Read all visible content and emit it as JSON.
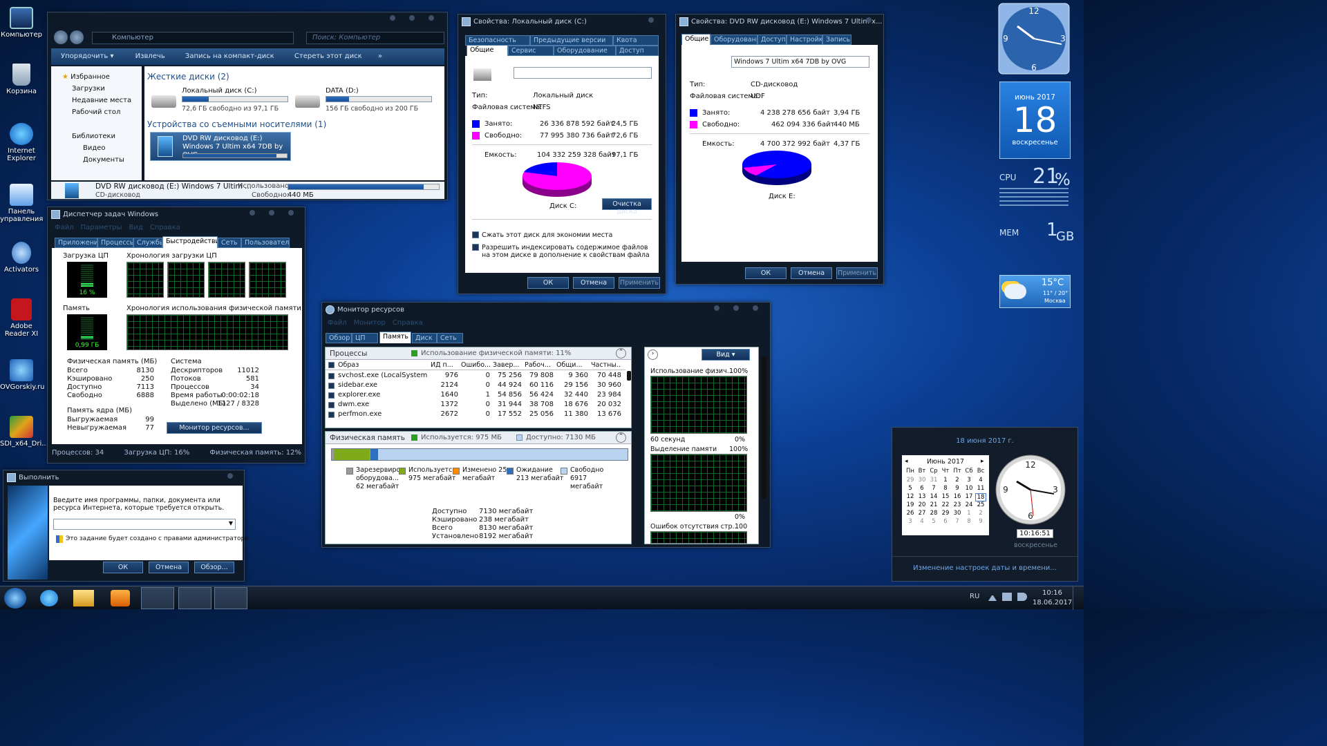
{
  "desktop_icons": [
    "Компьютер",
    "Корзина",
    "Internet Explorer",
    "Панель управления",
    "Activators",
    "Adobe Reader XI",
    "OVGorskiy.ru",
    "SDI_x64_Dri..."
  ],
  "explorer": {
    "address": "Компьютер",
    "search_placeholder": "Поиск: Компьютер",
    "toolbar": [
      "Упорядочить ▾",
      "Извлечь",
      "Запись на компакт-диск",
      "Стереть этот диск",
      "»"
    ],
    "nav": {
      "favorites": "Избранное",
      "fav_items": [
        "Загрузки",
        "Недавние места",
        "Рабочий стол"
      ],
      "libraries": "Библиотеки",
      "lib_items": [
        "Видео",
        "Документы"
      ]
    },
    "hdd_group": "Жесткие диски (2)",
    "drive_c": {
      "name": "Локальный диск (C:)",
      "free": "72,6 ГБ свободно из 97,1 ГБ",
      "used_fraction": 0.25
    },
    "drive_d": {
      "name": "DATA (D:)",
      "free": "156 ГБ свободно из 200 ГБ",
      "used_fraction": 0.22
    },
    "removable_group": "Устройства со съемными носителями (1)",
    "dvd_tile": "DVD RW дисковод (E:) Windows 7 Ultim x64 7DB by OVG",
    "details": {
      "name": "DVD RW дисковод (E:) Windows 7 Ultim ...",
      "type": "CD-дисковод",
      "used_label": "Использовано:",
      "free_label": "Свободно:",
      "free_value": "440 МБ",
      "used_fraction": 0.9
    }
  },
  "props_c": {
    "title": "Свойства: Локальный диск (C:)",
    "tabs_top": [
      "Безопасность",
      "Предыдущие версии",
      "Квота"
    ],
    "tabs_bottom": [
      "Общие",
      "Сервис",
      "Оборудование",
      "Доступ"
    ],
    "type_label": "Тип:",
    "type_value": "Локальный диск",
    "fs_label": "Файловая система:",
    "fs_value": "NTFS",
    "used_label": "Занято:",
    "used_bytes": "26 336 878 592 байт",
    "used_gb": "24,5 ГБ",
    "free_label": "Свободно:",
    "free_bytes": "77 995 380 736 байт",
    "free_gb": "72,6 ГБ",
    "cap_label": "Емкость:",
    "cap_bytes": "104 332 259 328 байт",
    "cap_gb": "97,1 ГБ",
    "disk_label": "Диск C:",
    "cleanup": "Очистка диска",
    "compress": "Сжать этот диск для экономии места",
    "index": "Разрешить индексировать содержимое файлов на этом диске в дополнение к свойствам файла",
    "buttons": [
      "ОК",
      "Отмена",
      "Применить"
    ],
    "used_color": "#0000ff",
    "free_color": "#ff00ff"
  },
  "props_e": {
    "title": "Свойства: DVD RW дисковод (E:) Windows 7 Ultim x...",
    "tabs": [
      "Общие",
      "Оборудование",
      "Доступ",
      "Настройка",
      "Запись"
    ],
    "label_value": "Windows 7 Ultim x64 7DB by OVG",
    "type_label": "Тип:",
    "type_value": "CD-дисковод",
    "fs_label": "Файловая система:",
    "fs_value": "UDF",
    "used_label": "Занято:",
    "used_bytes": "4 238 278 656 байт",
    "used_gb": "3,94 ГБ",
    "free_label": "Свободно:",
    "free_bytes": "462 094 336 байт",
    "free_gb": "440 МБ",
    "cap_label": "Емкость:",
    "cap_bytes": "4 700 372 992 байт",
    "cap_gb": "4,37 ГБ",
    "disk_label": "Диск E:",
    "buttons": [
      "ОК",
      "Отмена",
      "Применить"
    ]
  },
  "taskmgr": {
    "title": "Диспетчер задач Windows",
    "menu": [
      "Файл",
      "Параметры",
      "Вид",
      "Справка"
    ],
    "tabs": [
      "Приложения",
      "Процессы",
      "Службы",
      "Быстродействие",
      "Сеть",
      "Пользователи"
    ],
    "cpu_label": "Загрузка ЦП",
    "cpu_value": "16 %",
    "cpu_fraction": 0.16,
    "cpu_hist_label": "Хронология загрузки ЦП",
    "mem_label": "Память",
    "mem_value": "0,99 ГБ",
    "mem_fraction": 0.12,
    "mem_hist_label": "Хронология использования физической памяти",
    "phys_title": "Физическая память (МБ)",
    "phys": [
      [
        "Всего",
        "8130"
      ],
      [
        "Кэшировано",
        "250"
      ],
      [
        "Доступно",
        "7113"
      ],
      [
        "Свободно",
        "6888"
      ]
    ],
    "kernel_title": "Память ядра (МБ)",
    "kernel": [
      [
        "Выгружаемая",
        "99"
      ],
      [
        "Невыгружаемая",
        "77"
      ]
    ],
    "system_title": "Система",
    "system": [
      [
        "Дескрипторов",
        "11012"
      ],
      [
        "Потоков",
        "581"
      ],
      [
        "Процессов",
        "34"
      ],
      [
        "Время работы",
        "0:00:02:18"
      ],
      [
        "Выделено (МБ)",
        "1127 / 8328"
      ]
    ],
    "resmon_button": "Монитор ресурсов...",
    "status": [
      "Процессов: 34",
      "Загрузка ЦП: 16%",
      "Физическая память: 12%"
    ]
  },
  "resmon": {
    "title": "Монитор ресурсов",
    "menu": [
      "Файл",
      "Монитор",
      "Справка"
    ],
    "tabs": [
      "Обзор",
      "ЦП",
      "Память",
      "Диск",
      "Сеть"
    ],
    "proc_header": "Процессы",
    "proc_usage": "Использование физической памяти: 11%",
    "columns": [
      "Образ",
      "ИД п...",
      "Ошибо...",
      "Завер...",
      "Рабоч...",
      "Общи...",
      "Частны..."
    ],
    "rows": [
      [
        "svchost.exe (LocalSystemNet...",
        "976",
        "0",
        "75 256",
        "79 808",
        "9 360",
        "70 448"
      ],
      [
        "sidebar.exe",
        "2124",
        "0",
        "44 924",
        "60 116",
        "29 156",
        "30 960"
      ],
      [
        "explorer.exe",
        "1640",
        "1",
        "54 856",
        "56 424",
        "32 440",
        "23 984"
      ],
      [
        "dwm.exe",
        "1372",
        "0",
        "31 944",
        "38 708",
        "18 676",
        "20 032"
      ],
      [
        "perfmon.exe",
        "2672",
        "0",
        "17 552",
        "25 056",
        "11 380",
        "13 676"
      ]
    ],
    "phys_header": "Физическая память",
    "phys_used": "Используется: 975 МБ",
    "phys_avail": "Доступно: 7130 МБ",
    "legend": [
      {
        "label": "Зарезервиро оборудова... 62 мегабайт",
        "color": "#9a9a9a"
      },
      {
        "label": "Используется 975 мегабайт",
        "color": "#7fab1b"
      },
      {
        "label": "Изменено 25 мегабайт",
        "color": "#ff8c00"
      },
      {
        "label": "Ожидание 213 мегабайт",
        "color": "#2f6fbf"
      },
      {
        "label": "Свободно 6917 мегабайт",
        "color": "#b9d3f0"
      }
    ],
    "summary": [
      [
        "Доступно",
        "7130 мегабайт"
      ],
      [
        "Кэшировано",
        "238 мегабайт"
      ],
      [
        "Всего",
        "8130 мегабайт"
      ],
      [
        "Установлено",
        "8192 мегабайт"
      ]
    ],
    "view_button": "Вид",
    "graph1_label": "Использование физич...",
    "graph1_max": "100%",
    "graph1_x": "60 секунд",
    "graph1_min": "0%",
    "graph2_label": "Выделение памяти",
    "graph2_max": "100%",
    "graph2_min": "0%",
    "graph3_label": "Ошибок отсутствия стр...",
    "graph3_max": "100"
  },
  "run": {
    "title": "Выполнить",
    "desc": "Введите имя программы, папки, документа или ресурса Интернета, которые требуется открыть.",
    "admin": "Это задание будет создано с правами администратора",
    "buttons": [
      "ОК",
      "Отмена",
      "Обзор..."
    ]
  },
  "gadgets": {
    "calendar_month": "июнь 2017",
    "calendar_day": "18",
    "calendar_weekday": "воскресенье",
    "cpu_label": "CPU",
    "cpu_value": "21",
    "cpu_unit": "%",
    "mem_label": "MEM",
    "mem_value": "1",
    "mem_unit": "GB",
    "weather_temp": "15°C",
    "weather_range": "11° / 20°",
    "weather_city": "Москва"
  },
  "datetime_popup": {
    "date_header": "18 июня 2017 г.",
    "month": "Июнь 2017",
    "weekdays": [
      "Пн",
      "Вт",
      "Ср",
      "Чт",
      "Пт",
      "Сб",
      "Вс"
    ],
    "days": [
      [
        "29",
        "30",
        "31",
        "1",
        "2",
        "3",
        "4"
      ],
      [
        "5",
        "6",
        "7",
        "8",
        "9",
        "10",
        "11"
      ],
      [
        "12",
        "13",
        "14",
        "15",
        "16",
        "17",
        "18"
      ],
      [
        "19",
        "20",
        "21",
        "22",
        "23",
        "24",
        "25"
      ],
      [
        "26",
        "27",
        "28",
        "29",
        "30",
        "1",
        "2"
      ],
      [
        "3",
        "4",
        "5",
        "6",
        "7",
        "8",
        "9"
      ]
    ],
    "time": "10:16:51",
    "weekday": "воскресенье",
    "change_link": "Изменение настроек даты и времени..."
  },
  "taskbar": {
    "lang": "RU",
    "time": "10:16",
    "date": "18.06.2017"
  }
}
